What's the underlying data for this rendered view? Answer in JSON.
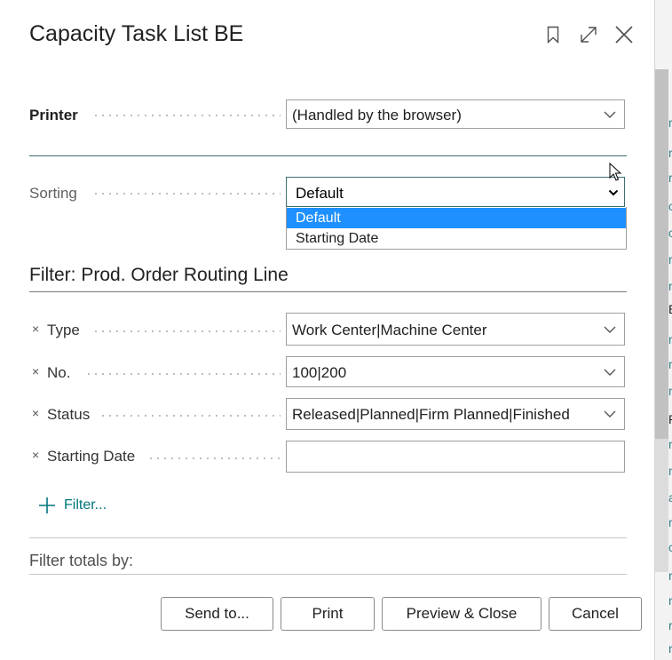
{
  "dialog": {
    "title": "Capacity Task List BE",
    "icons": [
      "bookmark-icon",
      "expand-icon",
      "close-icon"
    ]
  },
  "printer": {
    "label": "Printer",
    "value": "(Handled by the browser)"
  },
  "sorting": {
    "label": "Sorting",
    "value": "Default",
    "options": [
      "Default",
      "Starting Date"
    ],
    "highlighted": "Default"
  },
  "filter_section": {
    "title": "Filter: Prod. Order Routing Line",
    "remove_glyph": "×",
    "rows": [
      {
        "label": "Type",
        "value": "Work Center|Machine Center",
        "has_dropdown": true
      },
      {
        "label": "No.",
        "value": "100|200",
        "has_dropdown": true
      },
      {
        "label": "Status",
        "value": "Released|Planned|Firm Planned|Finished",
        "has_dropdown": true
      },
      {
        "label": "Starting Date",
        "value": "",
        "has_dropdown": false
      }
    ],
    "add_filter_label": "Filter..."
  },
  "totals": {
    "label": "Filter totals by:"
  },
  "buttons": {
    "send_to": "Send to...",
    "print": "Print",
    "preview_close": "Preview & Close",
    "cancel": "Cancel"
  },
  "background": {
    "glyphs": [
      "r",
      "r",
      "c",
      "c",
      "r",
      "r",
      "r",
      "E",
      "r",
      "r",
      "P",
      "r",
      "r",
      "a",
      "r",
      "c",
      "r",
      "r",
      "r",
      "r",
      "r"
    ]
  },
  "colors": {
    "accent": "#00757e",
    "selection": "#1e90ff",
    "divider": "#3d6f73"
  }
}
